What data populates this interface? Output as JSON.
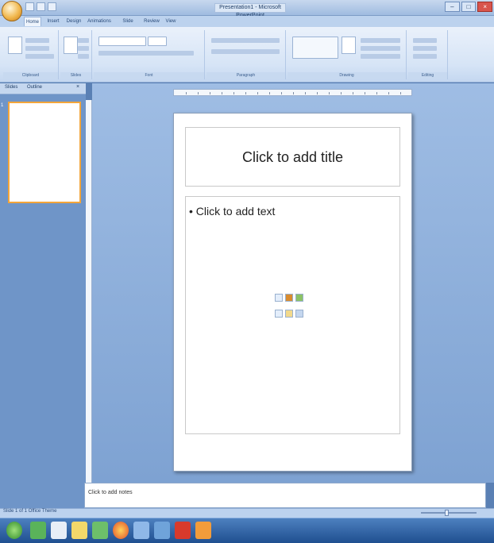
{
  "window": {
    "title": "Presentation1 - Microsoft PowerPoint",
    "controls": [
      "–",
      "□",
      "×"
    ]
  },
  "ribbon": {
    "tabs": [
      "Home",
      "Insert",
      "Design",
      "Animations",
      "Slide Show",
      "Review",
      "View"
    ],
    "active_tab": "Home",
    "groups": [
      "Clipboard",
      "Slides",
      "Font",
      "Paragraph",
      "Drawing",
      "Editing"
    ]
  },
  "left_pane": {
    "tabs": [
      "Slides",
      "Outline"
    ],
    "slide_number": "1"
  },
  "slide": {
    "title_placeholder": "Click to add title",
    "body_placeholder": "Click to add text"
  },
  "notes": {
    "placeholder": "Click to add notes"
  },
  "statusbar": {
    "left": "Slide 1 of 1   Office Theme"
  },
  "colors": {
    "ribbon": "#d6e4f6",
    "workspace": "#7ea2d2",
    "selection": "#f3a53a",
    "taskbar": "#1f4f90"
  },
  "icons": [
    "office-button-icon",
    "paste-icon",
    "new-slide-icon",
    "shapes-icon",
    "find-icon",
    "insert-table-icon",
    "insert-chart-icon",
    "insert-smartart-icon",
    "insert-picture-icon",
    "insert-clipart-icon",
    "insert-media-icon"
  ]
}
